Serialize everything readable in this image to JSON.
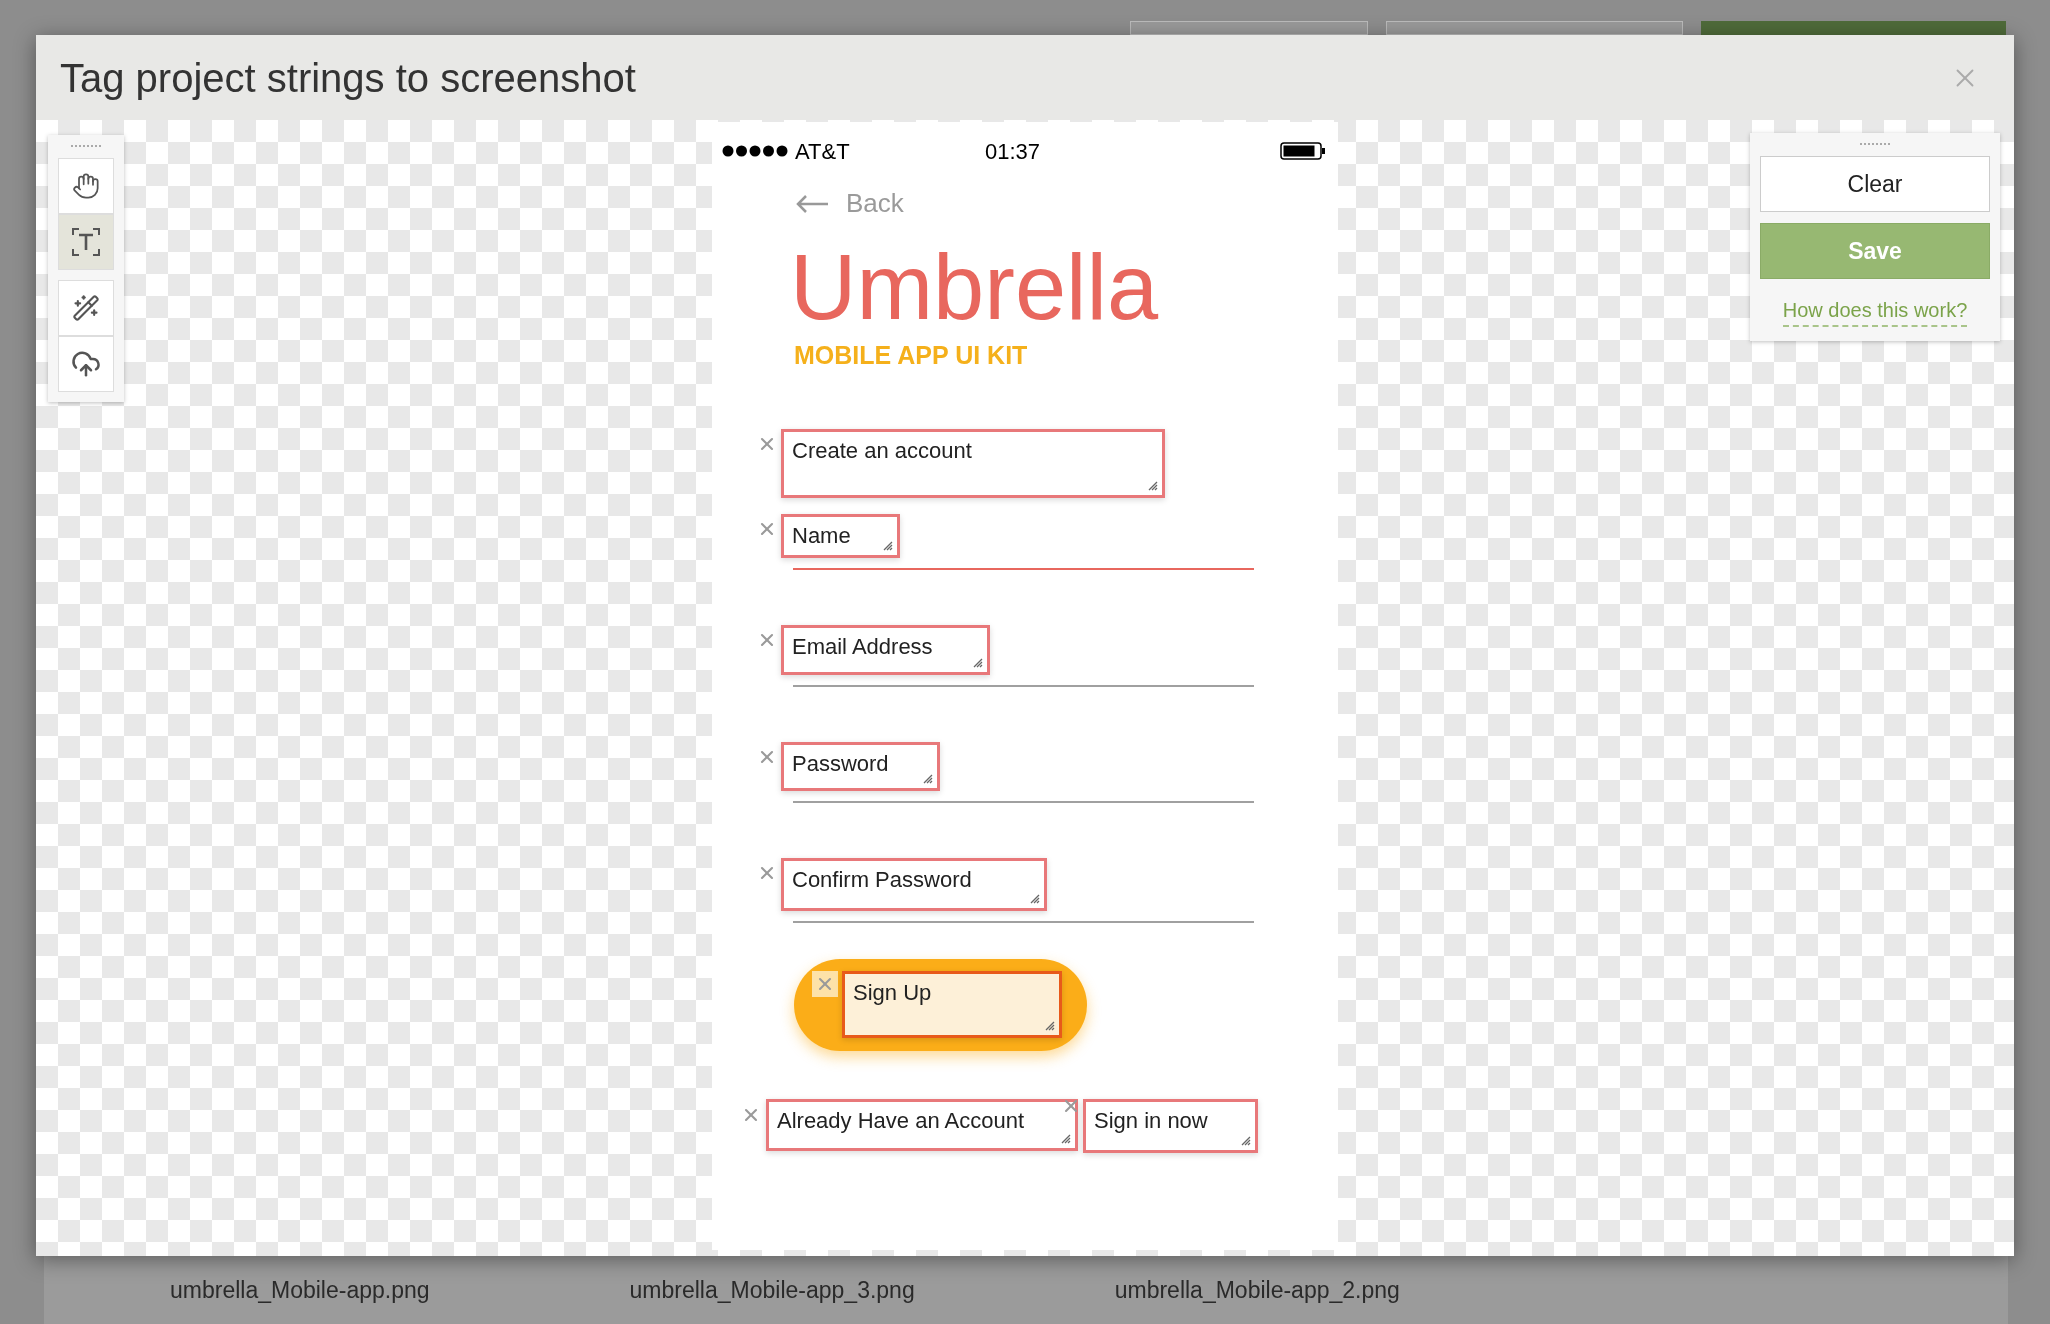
{
  "dialog": {
    "title": "Tag project strings to screenshot"
  },
  "tools": [
    {
      "kind": "hand",
      "selected": false
    },
    {
      "kind": "text",
      "selected": true
    },
    {
      "kind": "wand",
      "selected": false
    },
    {
      "kind": "upload",
      "selected": false
    }
  ],
  "screenshot": {
    "status_bar": {
      "carrier": "AT&T",
      "time": "01:37"
    },
    "back": "Back",
    "app_title": "Umbrella",
    "app_subtitle": "MOBILE APP UI KIT",
    "tags": [
      {
        "kind": "heading",
        "text": "Create an account"
      },
      {
        "kind": "field",
        "text": "Name",
        "active": true
      },
      {
        "kind": "field",
        "text": "Email Address",
        "active": false
      },
      {
        "kind": "field",
        "text": "Password",
        "active": false
      },
      {
        "kind": "field",
        "text": "Confirm Password",
        "active": false
      },
      {
        "kind": "button",
        "text": "Sign Up"
      }
    ],
    "footer_tags": [
      {
        "text": "Already Have an Account"
      },
      {
        "text": "Sign in now"
      }
    ]
  },
  "panel": {
    "buttons": [
      {
        "kind": "secondary",
        "label": "Clear"
      },
      {
        "kind": "primary",
        "label": "Save"
      }
    ],
    "help_link": "How does this work?"
  },
  "files": [
    "umbrella_Mobile-app.png",
    "umbrella_Mobile-app_3.png",
    "umbrella_Mobile-app_2.png"
  ]
}
